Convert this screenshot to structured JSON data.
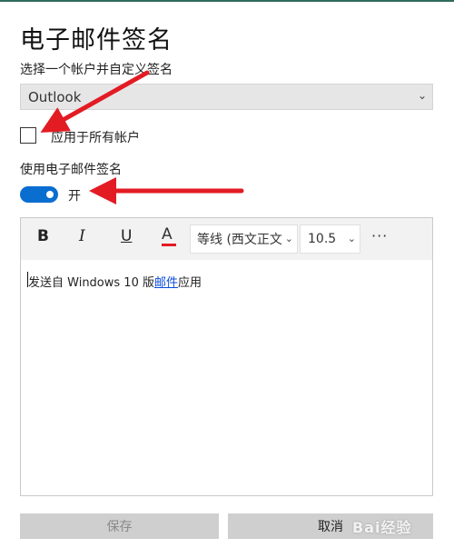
{
  "title": "电子邮件签名",
  "account": {
    "label": "选择一个帐户并自定义签名",
    "selected": "Outlook"
  },
  "apply_all": {
    "label": "应用于所有帐户",
    "checked": false
  },
  "use_signature": {
    "label": "使用电子邮件签名",
    "toggle_state": "开",
    "on": true
  },
  "toolbar": {
    "bold": "B",
    "italic": "I",
    "underline": "U",
    "font_color": "A",
    "font_name": "等线 (西文正文",
    "font_size": "10.5",
    "more": "···"
  },
  "editor": {
    "text_before": "发送自 Windows 10 版",
    "link": "邮件",
    "text_after": "应用"
  },
  "buttons": {
    "save": "保存",
    "cancel": "取消"
  },
  "watermark": "Bai经验",
  "colors": {
    "accent": "#0a6ed1",
    "annotation_arrow": "#e31b23",
    "link": "#0a4bd9"
  }
}
